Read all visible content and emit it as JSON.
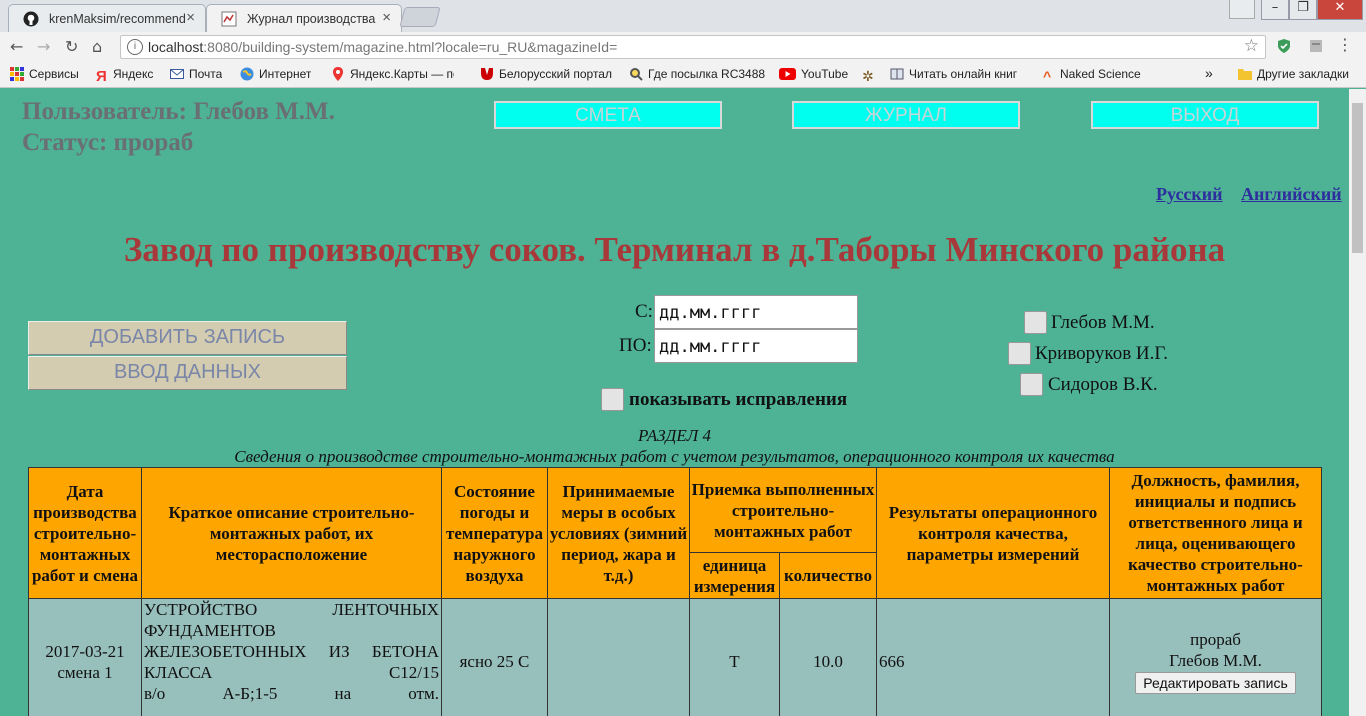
{
  "browser": {
    "tabs": [
      {
        "title": "krenMaksim/recommend",
        "close": "×"
      },
      {
        "title": "Журнал производства р",
        "close": "×"
      }
    ],
    "url_host": "localhost",
    "url_path": ":8080/building-system/magazine.html?locale=ru_RU&magazineId=",
    "bookmarks": [
      "Сервисы",
      "Яндекс",
      "Почта",
      "Интернет",
      "Яндекс.Карты — по",
      "Белорусский портал",
      "Где посылка RC3488",
      "YouTube",
      "Читать онлайн книг",
      "Naked Science"
    ],
    "bookmarks_more": "»",
    "other_bookmarks": "Другие закладки"
  },
  "header": {
    "user": "Пользователь: Глебов М.М.",
    "status": "Статус: прораб"
  },
  "nav": {
    "estimate": "СМЕТА",
    "journal": "ЖУРНАЛ",
    "exit": "ВЫХОД"
  },
  "lang": {
    "ru": "Русский",
    "en": "Английский"
  },
  "title": "Завод по производству соков. Терминал в д.Таборы Минского района",
  "actions": {
    "add": "ДОБАВИТЬ ЗАПИСЬ",
    "input": "ВВОД ДАННЫХ"
  },
  "filter": {
    "from_label": "С:",
    "to_label": "ПО:",
    "from_value": "дд.мм.гггг",
    "to_value": "дд.мм.гггг",
    "show_corrections": "показывать исправления"
  },
  "people": [
    "Глебов М.М.",
    "Криворуков И.Г.",
    "Сидоров В.К."
  ],
  "section": {
    "number": "РАЗДЕЛ 4",
    "caption": "Сведения о производстве строительно-монтажных работ с учетом результатов, операционного контроля их качества"
  },
  "table": {
    "headers": {
      "date": "Дата производства строительно-монтажных работ и смена",
      "desc": "Краткое описание строительно-монтажных работ, их месторасположение",
      "weather": "Состояние погоды и температура наружного воздуха",
      "measures": "Принимаемые меры в особых условиях (зимний период, жара и т.д.)",
      "acceptance": "Приемка выполненных строительно-монтажных работ",
      "unit": "единица измерения",
      "qty": "количество",
      "results": "Результаты операционного контроля качества, параметры измерений",
      "signer": "Должность, фамилия, инициалы и подпись ответственного лица и лица, оценивающего качество строительно-монтажных работ"
    },
    "rows": [
      {
        "date": "2017-03-21",
        "shift": "смена 1",
        "desc": "УСТРОЙСТВО ЛЕНТОЧНЫХ ФУНДАМЕНТОВ ЖЕЛЕЗОБЕТОННЫХ ИЗ БЕТОНА КЛАССА С12/15",
        "desc_loc": "в/о А-Б;1-5 на отм.",
        "weather": "ясно 25 С",
        "measures": "",
        "unit": "Т",
        "qty": "10.0",
        "results": "666",
        "role": "прораб",
        "name": "Глебов М.М.",
        "edit": "Редактировать запись"
      }
    ]
  },
  "colors": {
    "page_bg": "#4db394",
    "title": "#a8383a",
    "table_header": "#ffa500",
    "table_cell": "#97bfbc",
    "nav_button": "#00ffee"
  }
}
